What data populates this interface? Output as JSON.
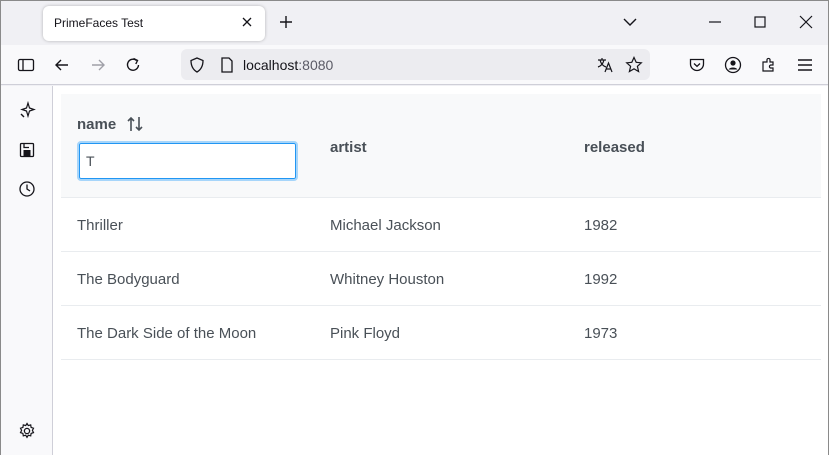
{
  "browser": {
    "tab_title": "PrimeFaces Test",
    "url_host": "localhost",
    "url_port": ":8080"
  },
  "table": {
    "columns": [
      {
        "label": "name",
        "sortable": true
      },
      {
        "label": "artist",
        "sortable": false
      },
      {
        "label": "released",
        "sortable": false
      }
    ],
    "filter_value": "T",
    "rows": [
      {
        "name": "Thriller",
        "artist": "Michael Jackson",
        "released": "1982"
      },
      {
        "name": "The Bodyguard",
        "artist": "Whitney Houston",
        "released": "1992"
      },
      {
        "name": "The Dark Side of the Moon",
        "artist": "Pink Floyd",
        "released": "1973"
      }
    ]
  },
  "icons": {
    "sort": "sort-alt-icon",
    "sidebar_ai": "ai-sparkle-icon",
    "sidebar_save": "save-to-pocket-icon",
    "sidebar_history": "history-icon",
    "sidebar_settings": "gear-icon"
  }
}
